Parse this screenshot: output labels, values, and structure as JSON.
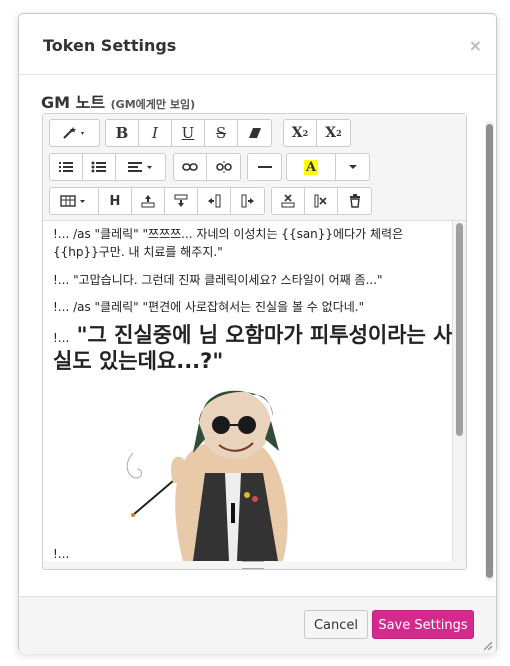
{
  "dialog": {
    "title": "Token Settings",
    "close_label": "×"
  },
  "field": {
    "label": "GM 노트",
    "label_note": "(GM에게만 보임)"
  },
  "toolbar": {
    "row1": [
      {
        "name": "magic-wand-dropdown",
        "glyph": "✨ ▾"
      },
      {
        "name": "bold-button",
        "glyph": "B"
      },
      {
        "name": "italic-button",
        "glyph": "I"
      },
      {
        "name": "underline-button",
        "glyph": "U"
      },
      {
        "name": "strikethrough-button",
        "glyph": "S"
      },
      {
        "name": "eraser-button",
        "glyph": "⌫"
      },
      {
        "name": "superscript-button",
        "glyph": "X²"
      },
      {
        "name": "subscript-button",
        "glyph": "X₂"
      }
    ],
    "row2": [
      {
        "name": "ordered-list-button",
        "glyph": "☰"
      },
      {
        "name": "unordered-list-button",
        "glyph": "☰"
      },
      {
        "name": "align-dropdown",
        "glyph": "≡ ▾"
      },
      {
        "name": "link-button",
        "glyph": "🔗"
      },
      {
        "name": "unlink-button",
        "glyph": "⛓"
      },
      {
        "name": "horizontal-rule-button",
        "glyph": "—"
      },
      {
        "name": "highlight-color-button",
        "glyph": "A"
      },
      {
        "name": "color-dropdown",
        "glyph": "▾"
      }
    ],
    "row3": [
      {
        "name": "table-dropdown",
        "glyph": "▦ ▾"
      },
      {
        "name": "heading-button",
        "glyph": "H"
      },
      {
        "name": "insert-row-above-button",
        "glyph": "⇧"
      },
      {
        "name": "insert-row-below-button",
        "glyph": "⇩"
      },
      {
        "name": "insert-column-left-button",
        "glyph": "⇤"
      },
      {
        "name": "insert-column-right-button",
        "glyph": "⇥"
      },
      {
        "name": "delete-row-button",
        "glyph": "✖"
      },
      {
        "name": "delete-column-button",
        "glyph": "✗"
      },
      {
        "name": "delete-table-button",
        "glyph": "🗑"
      }
    ]
  },
  "content": {
    "line1": "!... /as \"클레릭\" \"쯔쯔쯔... 자네의 이성치는 {{san}}에다가 체력은 {{hp}}구만. 내 치료를 해주지.\"",
    "line2": "!... \"고맙습니다. 그런데 진짜 클레릭이세요? 스타일이 어째 좀...\"",
    "line3": "!... /as \"클레릭\" \"편견에 사로잡혀서는 진실을 볼 수 없다네.\"",
    "big_lead": "!...",
    "big_text": "\"그 진실중에 님 오함마가 피투성이라는 사실도 있는데요...?\"",
    "last": "!..."
  },
  "footer": {
    "cancel_label": "Cancel",
    "save_label": "Save Settings"
  },
  "colors": {
    "save_button": "#d6298d",
    "highlight_yellow": "#ffff00"
  }
}
